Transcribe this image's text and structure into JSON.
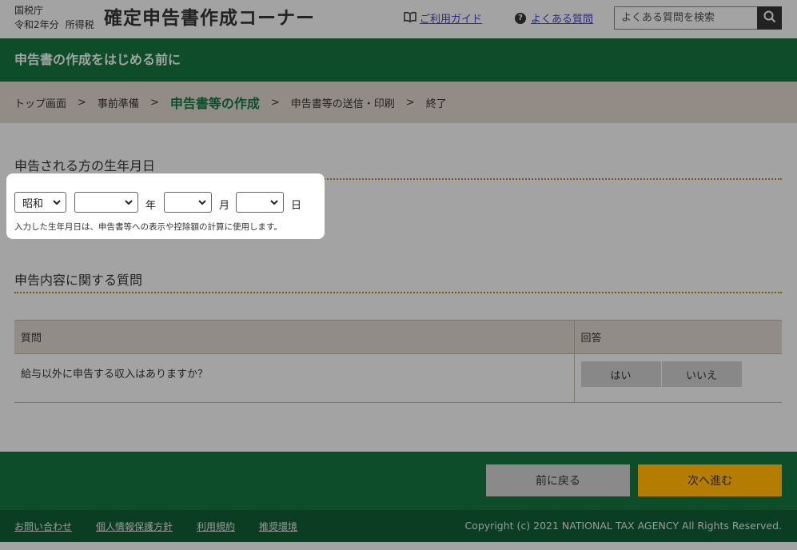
{
  "header": {
    "agency": "国税庁",
    "year": "令和2年分",
    "tax_type": "所得税",
    "title": "確定申告書作成コーナー",
    "guide_link": "ご利用ガイド",
    "faq_link": "よくある質問",
    "search_placeholder": "よくある質問を検索",
    "icons": {
      "guide": "book-icon",
      "faq": "question-circle-icon",
      "search": "search-icon"
    }
  },
  "title_bar": "申告書の作成をはじめる前に",
  "breadcrumb": {
    "items": [
      "トップ画面",
      "事前準備",
      "申告書等の作成",
      "申告書等の送信・印刷",
      "終了"
    ],
    "current_index": 2
  },
  "birthdate": {
    "heading": "申告される方の生年月日",
    "era": "昭和",
    "year_value": "",
    "month_value": "",
    "day_value": "",
    "year_unit": "年",
    "month_unit": "月",
    "day_unit": "日",
    "help": "入力した生年月日は、申告書等への表示や控除額の計算に使用します。"
  },
  "questions": {
    "heading": "申告内容に関する質問",
    "col_question": "質問",
    "col_answer": "回答",
    "rows": [
      {
        "question": "給与以外に申告する収入はありますか？",
        "yes": "はい",
        "no": "いいえ"
      }
    ]
  },
  "actions": {
    "back": "前に戻る",
    "next": "次へ進む"
  },
  "footer": {
    "links": [
      "お問い合わせ",
      "個人情報保護方針",
      "利用規約",
      "推奨環境"
    ],
    "copyright": "Copyright (c) 2021 NATIONAL TAX AGENCY All Rights Reserved."
  },
  "colors": {
    "green": "#0d4d2a",
    "next_button": "#b57d00",
    "overlay": "#a3a3a3"
  }
}
